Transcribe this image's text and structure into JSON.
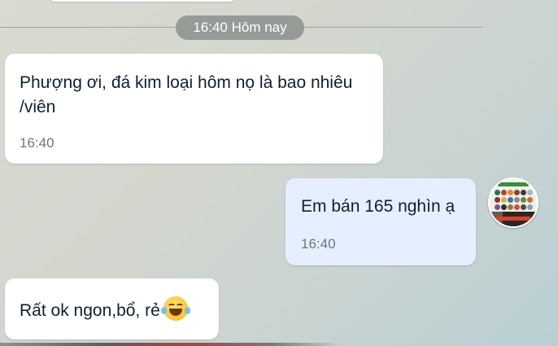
{
  "date_divider": "16:40 Hôm nay",
  "messages": [
    {
      "direction": "incoming",
      "text": "Phượng ơi, đá kim loại hôm nọ là bao nhiêu /viên",
      "time": "16:40"
    },
    {
      "direction": "outgoing",
      "text": "Em bán 165 nghìn ạ",
      "time": "16:40"
    },
    {
      "direction": "incoming",
      "text": "Rất ok ngon,bổ, rẻ",
      "emoji": "laughing-tears-emoji"
    }
  ],
  "avatar_icon": "store-avatar-icon",
  "colors": {
    "outgoing_bubble": "#e5efff",
    "incoming_bubble": "#ffffff",
    "divider_pill": "#8c918e",
    "text": "#0f2033",
    "time_text": "#6f757b"
  }
}
